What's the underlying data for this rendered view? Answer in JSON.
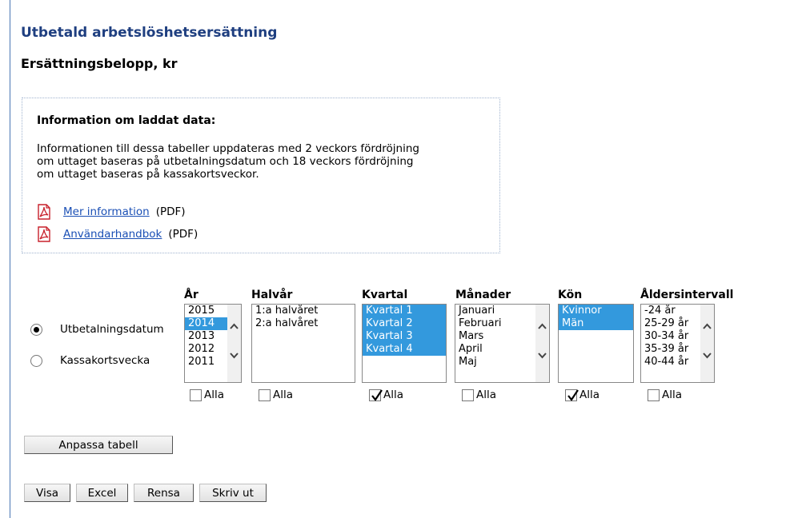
{
  "header": {
    "title": "Utbetald arbetslöshetsersättning",
    "subtitle": "Ersättningsbelopp, kr"
  },
  "info": {
    "heading": "Information om laddat data:",
    "text": "Informationen till dessa tabeller uppdateras med 2 veckors fördröjning\nom uttaget baseras på utbetalningsdatum och 18 veckors fördröjning\nom uttaget baseras på kassakortsveckor.",
    "links": [
      {
        "label": "Mer information",
        "type": "(PDF)",
        "icon": "pdf-icon"
      },
      {
        "label": "Användarhandbok",
        "type": "(PDF)",
        "icon": "pdf-icon"
      }
    ]
  },
  "date_basis": {
    "options": [
      {
        "label": "Utbetalningsdatum",
        "checked": true
      },
      {
        "label": "Kassakortsvecka",
        "checked": false
      }
    ]
  },
  "filters": {
    "year": {
      "header": "År",
      "options": [
        "2015",
        "2014",
        "2013",
        "2012",
        "2011"
      ],
      "selected": [
        "2014"
      ],
      "all_label": "Alla",
      "all_checked": false
    },
    "halfyear": {
      "header": "Halvår",
      "options": [
        "1:a halvåret",
        "2:a halvåret"
      ],
      "selected": [],
      "all_label": "Alla",
      "all_checked": false
    },
    "quarter": {
      "header": "Kvartal",
      "options": [
        "Kvartal 1",
        "Kvartal 2",
        "Kvartal 3",
        "Kvartal 4"
      ],
      "selected": [
        "Kvartal 1",
        "Kvartal 2",
        "Kvartal 3",
        "Kvartal 4"
      ],
      "all_label": "Alla",
      "all_checked": true
    },
    "month": {
      "header": "Månader",
      "options": [
        "Januari",
        "Februari",
        "Mars",
        "April",
        "Maj"
      ],
      "selected": [],
      "all_label": "Alla",
      "all_checked": false
    },
    "gender": {
      "header": "Kön",
      "options": [
        "Kvinnor",
        "Män"
      ],
      "selected": [
        "Kvinnor",
        "Män"
      ],
      "all_label": "Alla",
      "all_checked": true
    },
    "age": {
      "header": "Åldersintervall",
      "options": [
        "-24 år",
        "25-29 år",
        "30-34 år",
        "35-39 år",
        "40-44 år"
      ],
      "selected": [],
      "all_label": "Alla",
      "all_checked": false
    }
  },
  "buttons": {
    "customize": "Anpassa tabell",
    "show": "Visa",
    "excel": "Excel",
    "clear": "Rensa",
    "print": "Skriv ut"
  },
  "colors": {
    "title": "#1f3f80",
    "link": "#1a4fb5",
    "selection": "#3399dd"
  }
}
